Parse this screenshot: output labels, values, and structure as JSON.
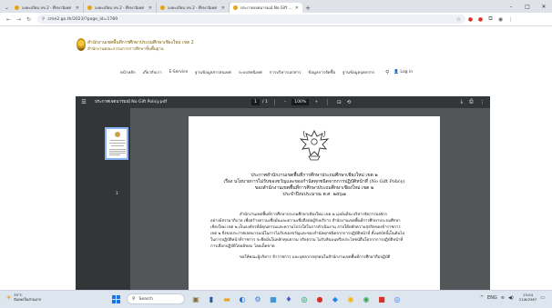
{
  "browser": {
    "tabs": [
      {
        "title": "ลงทะเบียน ลข 2 - ศึกษานิเทศ",
        "active": false
      },
      {
        "title": "ลงทะเบียน ลข 2 - ศึกษานิเทศ",
        "active": false
      },
      {
        "title": "ลงทะเบียน ลข 2 - ศึกษานิเทศ",
        "active": false
      },
      {
        "title": "ประกาศเจตนารมณ์ No Gift Policy",
        "active": true
      }
    ],
    "new_tab": "+",
    "window_controls": [
      "–",
      "□",
      "✕"
    ],
    "url": "cme2.go.th/2023/?page_id=1789"
  },
  "site": {
    "org_line1": "สำนักงานเขตพื้นที่การศึกษาประถมศึกษาเชียงใหม่ เขต 2",
    "org_line2": "สำนักงานคณะกรรมการการศึกษาขั้นพื้นฐาน",
    "menu": [
      "หน้าหลัก",
      "เกี่ยวกับเรา",
      "E-Service",
      "ฐานข้อมูลสารสนเทศ",
      "ระบบสหนิเทศ",
      "การบริหารเอกสาร",
      "ข้อมูลการจัดซื้อ",
      "ฐานข้อมูลบุคลากร"
    ],
    "login": "Log in"
  },
  "pdf": {
    "filename": "ประกาศเจตนารมณ์ No Gift Policy.pdf",
    "page_current": "1",
    "page_total": "/ 1",
    "zoom": "100%",
    "thumb_number": "1",
    "doc": {
      "heading1": "ประกาศสำนักงานเขตพื้นที่การศึกษาประถมศึกษาเชียงใหม่ เขต ๒",
      "heading2": "เรื่อง นโยบายการไม่รับของขวัญและของกำนัลทุกชนิดจากการปฏิบัติหน้าที่ (No Gift Policy)",
      "heading3": "ของสำนักงานเขตพื้นที่การศึกษาประถมศึกษาเชียงใหม่ เขต ๒",
      "heading4": "ประจำปีงบประมาณ พ.ศ. ๒๕๖๗",
      "body": [
        "สำนักงานเขตพื้นที่การศึกษาประถมศึกษาเชียงใหม่ เขต ๒ มุ่งมั่นที่จะบริหารจัดการองค์กร",
        "อย่างมีธรรมาภิบาล เพื่อสร้างความเชื่อมั่นและความเชื่อถือต่อผู้รับบริการ สำนักงานเขตพื้นที่การศึกษาประถมศึกษา",
        "เชียงใหม่ เขต ๒ เป็นองค์กรที่มีคุณธรรมและความโปร่งใสในการดำเนินงาน ภายใต้หลักความสุจริตของข้าราชการ",
        "เขต ๒ จึงขอประกาศเจตนารมณ์ในการไม่รับของขวัญและของกำนัลทุกชนิดจากการปฏิบัติหน้าที่ ตั้งแต่บัดนี้เป็นต้นไป",
        "ในการปฏิบัติหน้าที่ราชการ จะยึดมั่นในหลักคุณธรรม จริยธรรม ไม่รับสินบนหรือประโยชน์อื่นใดจากการปฏิบัติหน้าที่",
        "การเลือกปฏิบัติโดยมิชอบ โดยเด็ดขาด"
      ],
      "body2": "ขอให้คณะผู้บริหาร ข้าราชการ และบุคลากรทุกคนในสำนักงานเขตพื้นที่การศึกษาถือปฏิบัติ"
    }
  },
  "taskbar": {
    "weather_temp": "35°C",
    "weather_desc": "มีแดดเป็นส่วนมาก",
    "search": "Search",
    "lang": "ENG",
    "time": "15:04",
    "date": "21/6/2567"
  },
  "colors": {
    "pdf_bg": "#525659",
    "pdf_toolbar": "#323639",
    "accent": "#1a73e8",
    "org_text": "#7a5a00"
  }
}
